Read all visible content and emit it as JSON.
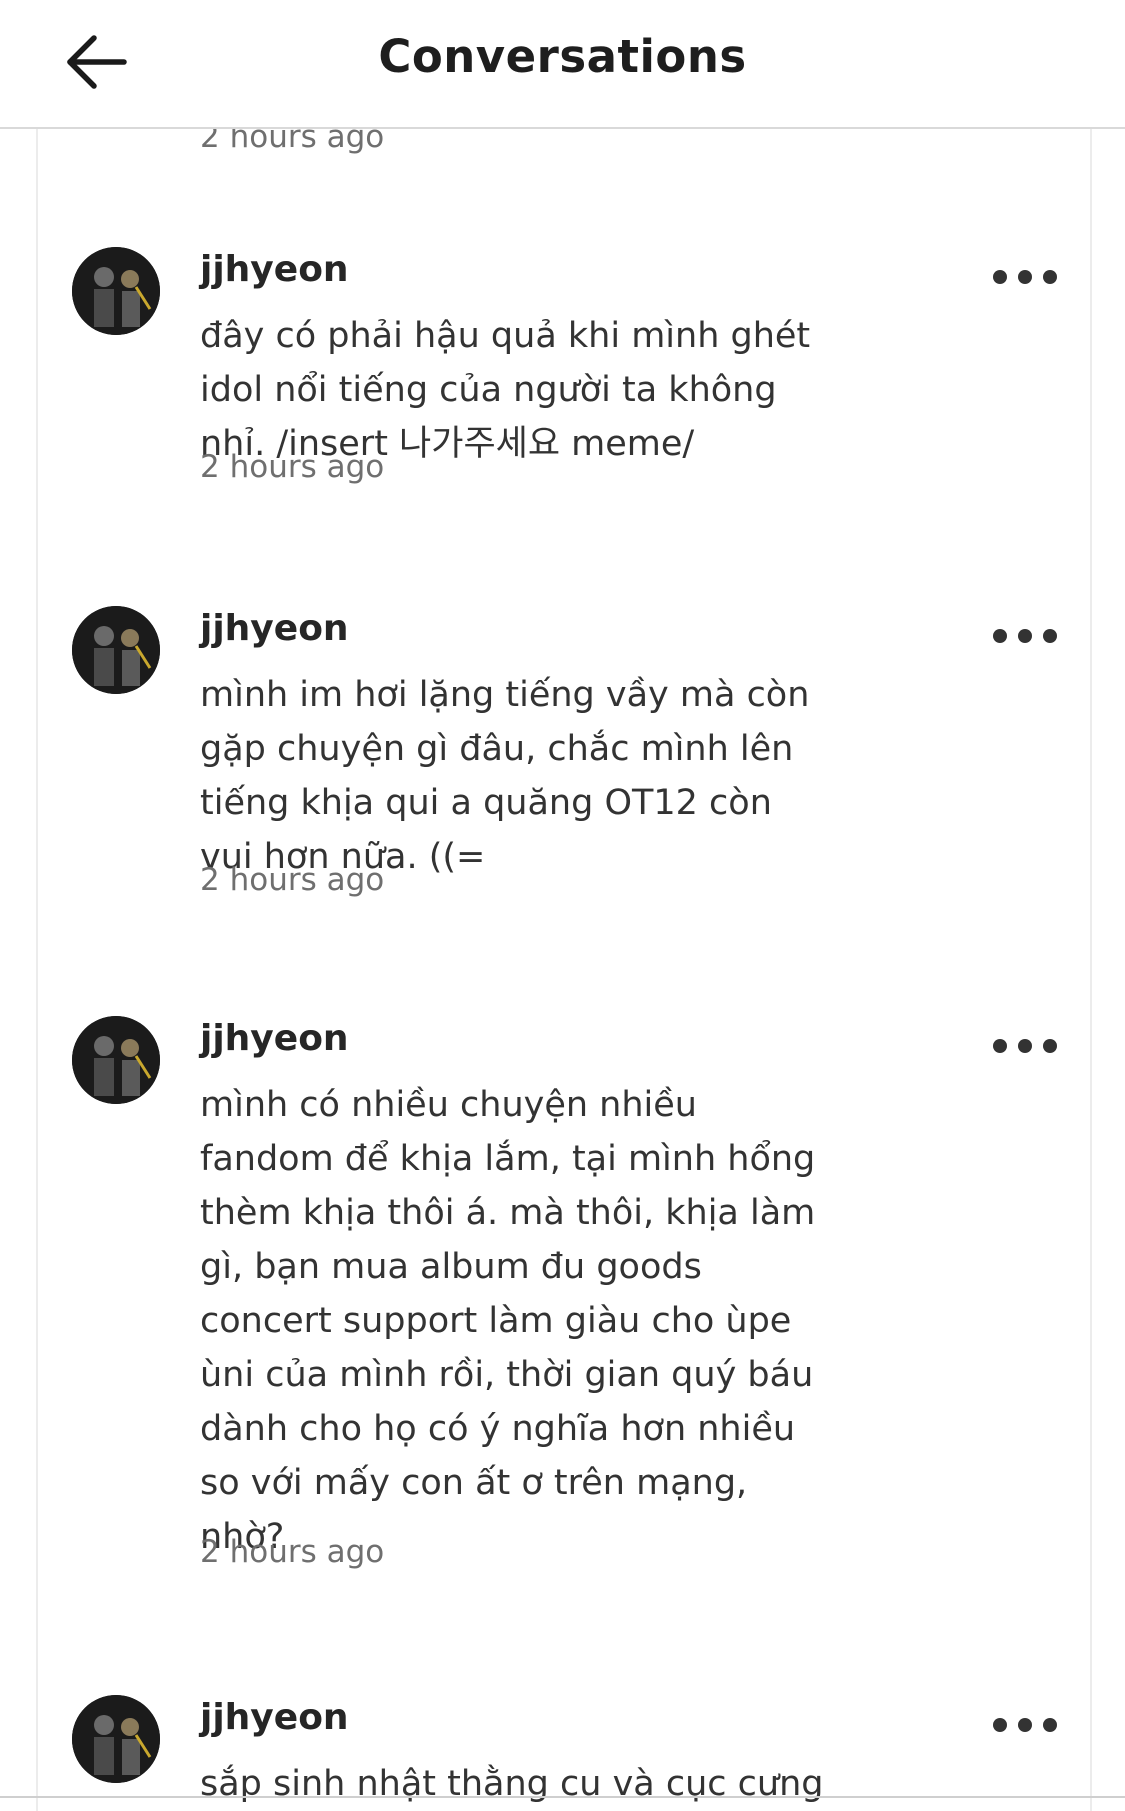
{
  "header": {
    "title": "Conversations",
    "back_icon": "arrow-left-icon"
  },
  "feed": {
    "top_timestamp": "2 hours ago",
    "comments": [
      {
        "username": "jjhyeon",
        "text": "đây có phải hậu quả khi mình ghét\nidol nổi tiếng của người ta không\nnhỉ. /insert 나가주세요 meme/",
        "timestamp": "2 hours ago",
        "more_icon": "more-horizontal-icon"
      },
      {
        "username": "jjhyeon",
        "text": "mình im hơi lặng tiếng vầy mà còn\ngặp chuyện gì đâu, chắc mình lên\ntiếng khịa qui a quăng OT12 còn\nvui hơn nữa. ((=",
        "timestamp": "2 hours ago",
        "more_icon": "more-horizontal-icon"
      },
      {
        "username": "jjhyeon",
        "text": "mình có nhiều chuyện nhiều\nfandom để khịa lắm, tại mình hổng\nthèm khịa thôi á. mà thôi, khịa làm\ngì, bạn mua album đu goods\nconcert support làm giàu cho ùpe\nùni của mình rồi, thời gian quý báu\ndành cho họ có ý nghĩa hơn nhiều\nso với mấy con ất ơ trên mạng,\nnhờ?",
        "timestamp": "2 hours ago",
        "more_icon": "more-horizontal-icon"
      },
      {
        "username": "jjhyeon",
        "text": "sắp sinh nhật thằng cu và cục cưng",
        "timestamp": "",
        "more_icon": "more-horizontal-icon"
      }
    ]
  }
}
